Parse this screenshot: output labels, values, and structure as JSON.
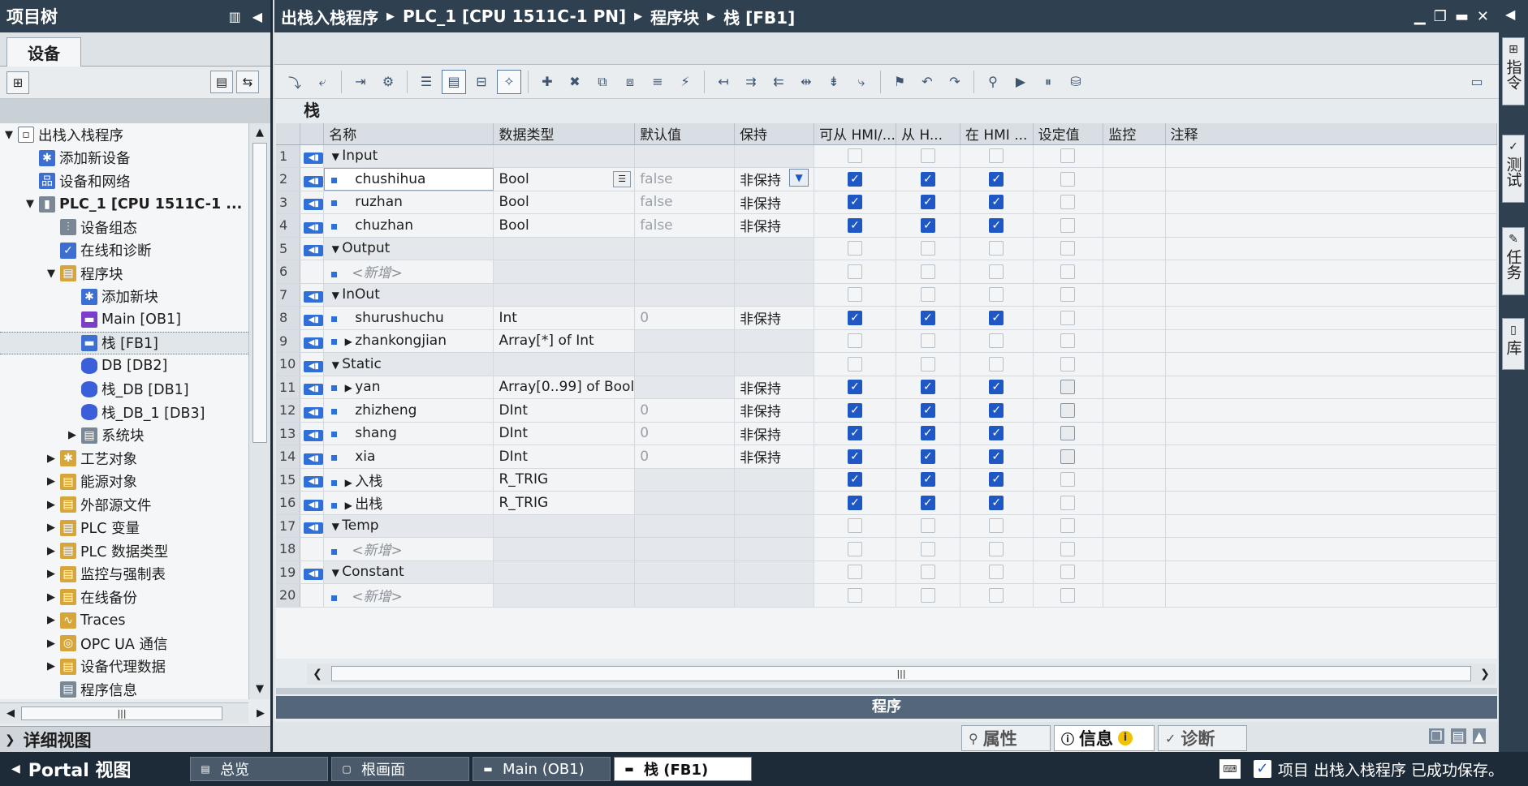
{
  "left": {
    "title": "项目树",
    "tab_devices": "设备",
    "tree": [
      {
        "label": "出栈入栈程序",
        "indent": 0,
        "arrow": "▼",
        "icon": "page",
        "glyph": "▫"
      },
      {
        "label": "添加新设备",
        "indent": 1,
        "arrow": "",
        "icon": "blue",
        "glyph": "✱"
      },
      {
        "label": "设备和网络",
        "indent": 1,
        "arrow": "",
        "icon": "blue",
        "glyph": "品"
      },
      {
        "label": "PLC_1 [CPU 1511C-1 ...",
        "indent": 1,
        "arrow": "▼",
        "icon": "gray",
        "glyph": "▮",
        "bold": true
      },
      {
        "label": "设备组态",
        "indent": 2,
        "arrow": "",
        "icon": "gray",
        "glyph": "⫶"
      },
      {
        "label": "在线和诊断",
        "indent": 2,
        "arrow": "",
        "icon": "blue",
        "glyph": "✓"
      },
      {
        "label": "程序块",
        "indent": 2,
        "arrow": "▼",
        "icon": "folder",
        "glyph": "▤"
      },
      {
        "label": "添加新块",
        "indent": 3,
        "arrow": "",
        "icon": "blue",
        "glyph": "✱"
      },
      {
        "label": "Main [OB1]",
        "indent": 3,
        "arrow": "",
        "icon": "purple",
        "glyph": "▬"
      },
      {
        "label": "栈 [FB1]",
        "indent": 3,
        "arrow": "",
        "icon": "blue",
        "glyph": "▬",
        "selected": true
      },
      {
        "label": "DB [DB2]",
        "indent": 3,
        "arrow": "",
        "icon": "db",
        "glyph": ""
      },
      {
        "label": "栈_DB [DB1]",
        "indent": 3,
        "arrow": "",
        "icon": "db",
        "glyph": ""
      },
      {
        "label": "栈_DB_1 [DB3]",
        "indent": 3,
        "arrow": "",
        "icon": "db",
        "glyph": ""
      },
      {
        "label": "系统块",
        "indent": 3,
        "arrow": "▶",
        "icon": "gray",
        "glyph": "▤"
      },
      {
        "label": "工艺对象",
        "indent": 2,
        "arrow": "▶",
        "icon": "folder",
        "glyph": "✱"
      },
      {
        "label": "能源对象",
        "indent": 2,
        "arrow": "▶",
        "icon": "folder",
        "glyph": "▤"
      },
      {
        "label": "外部源文件",
        "indent": 2,
        "arrow": "▶",
        "icon": "folder",
        "glyph": "▤"
      },
      {
        "label": "PLC 变量",
        "indent": 2,
        "arrow": "▶",
        "icon": "folder",
        "glyph": "▤"
      },
      {
        "label": "PLC 数据类型",
        "indent": 2,
        "arrow": "▶",
        "icon": "folder",
        "glyph": "▤"
      },
      {
        "label": "监控与强制表",
        "indent": 2,
        "arrow": "▶",
        "icon": "folder",
        "glyph": "▤"
      },
      {
        "label": "在线备份",
        "indent": 2,
        "arrow": "▶",
        "icon": "folder",
        "glyph": "▤"
      },
      {
        "label": "Traces",
        "indent": 2,
        "arrow": "▶",
        "icon": "folder",
        "glyph": "∿"
      },
      {
        "label": "OPC UA 通信",
        "indent": 2,
        "arrow": "▶",
        "icon": "folder",
        "glyph": "◎"
      },
      {
        "label": "设备代理数据",
        "indent": 2,
        "arrow": "▶",
        "icon": "folder",
        "glyph": "▤"
      },
      {
        "label": "程序信息",
        "indent": 2,
        "arrow": "",
        "icon": "gray",
        "glyph": "▤"
      }
    ],
    "detail_view": "详细视图"
  },
  "main": {
    "breadcrumb": [
      "出栈入栈程序",
      "PLC_1 [CPU 1511C-1 PN]",
      "程序块",
      "栈 [FB1]"
    ],
    "block_name": "栈",
    "columns": [
      "名称",
      "数据类型",
      "默认值",
      "保持",
      "可从 HMI/...",
      "从 H...",
      "在 HMI ...",
      "设定值",
      "监控",
      "注释"
    ],
    "rows": [
      {
        "n": "1",
        "name": "Input",
        "kind": "section",
        "iface": true
      },
      {
        "n": "2",
        "name": "chushihua",
        "type": "Bool",
        "def": "false",
        "ret": "非保持",
        "h1": true,
        "h2": true,
        "h3": true,
        "sp": "off",
        "sel": true
      },
      {
        "n": "3",
        "name": "ruzhan",
        "type": "Bool",
        "def": "false",
        "ret": "非保持",
        "h1": true,
        "h2": true,
        "h3": true,
        "sp": "off"
      },
      {
        "n": "4",
        "name": "chuzhan",
        "type": "Bool",
        "def": "false",
        "ret": "非保持",
        "h1": true,
        "h2": true,
        "h3": true,
        "sp": "off"
      },
      {
        "n": "5",
        "name": "Output",
        "kind": "section",
        "iface": true
      },
      {
        "n": "6",
        "name": "<新增>",
        "kind": "add"
      },
      {
        "n": "7",
        "name": "InOut",
        "kind": "section",
        "iface": true
      },
      {
        "n": "8",
        "name": "shurushuchu",
        "type": "Int",
        "def": "0",
        "ret": "非保持",
        "h1": true,
        "h2": true,
        "h3": true,
        "sp": "off"
      },
      {
        "n": "9",
        "name": "zhankongjian",
        "type": "Array[*] of Int",
        "def": "",
        "ret": "",
        "h1": false,
        "h2": false,
        "h3": false,
        "sp": "off",
        "expand": true
      },
      {
        "n": "10",
        "name": "Static",
        "kind": "section",
        "iface": true
      },
      {
        "n": "11",
        "name": "yan",
        "type": "Array[0..99] of Bool",
        "def": "",
        "ret": "非保持",
        "h1": true,
        "h2": true,
        "h3": true,
        "sp": "mid",
        "expand": true
      },
      {
        "n": "12",
        "name": "zhizheng",
        "type": "DInt",
        "def": "0",
        "ret": "非保持",
        "h1": true,
        "h2": true,
        "h3": true,
        "sp": "mid"
      },
      {
        "n": "13",
        "name": "shang",
        "type": "DInt",
        "def": "0",
        "ret": "非保持",
        "h1": true,
        "h2": true,
        "h3": true,
        "sp": "mid"
      },
      {
        "n": "14",
        "name": "xia",
        "type": "DInt",
        "def": "0",
        "ret": "非保持",
        "h1": true,
        "h2": true,
        "h3": true,
        "sp": "mid"
      },
      {
        "n": "15",
        "name": "入栈",
        "type": "R_TRIG",
        "def": "",
        "ret": "",
        "h1": true,
        "h2": true,
        "h3": true,
        "sp": "off",
        "expand": true
      },
      {
        "n": "16",
        "name": "出栈",
        "type": "R_TRIG",
        "def": "",
        "ret": "",
        "h1": true,
        "h2": true,
        "h3": true,
        "sp": "off",
        "expand": true
      },
      {
        "n": "17",
        "name": "Temp",
        "kind": "section",
        "iface": true
      },
      {
        "n": "18",
        "name": "<新增>",
        "kind": "add"
      },
      {
        "n": "19",
        "name": "Constant",
        "kind": "section",
        "iface": true
      },
      {
        "n": "20",
        "name": "<新增>",
        "kind": "add"
      }
    ],
    "program_bar": "程序",
    "inspector_tabs": {
      "properties": "属性",
      "info": "信息",
      "diagnostics": "诊断"
    }
  },
  "rightbar": {
    "tabs": [
      "指令",
      "测试",
      "任务",
      "库"
    ]
  },
  "statusbar": {
    "portal": "Portal 视图",
    "tabs": [
      {
        "label": "总览",
        "icon": "▤",
        "active": false,
        "width": 170
      },
      {
        "label": "根画面",
        "icon": "▢",
        "active": false,
        "width": 170
      },
      {
        "label": "Main (OB1)",
        "icon": "▬",
        "active": false,
        "width": 170
      },
      {
        "label": "栈 (FB1)",
        "icon": "▬",
        "active": true,
        "width": 170
      }
    ],
    "message": "项目 出栈入栈程序 已成功保存。"
  },
  "colors": {
    "title_bar": "#2f4050",
    "accent": "#1f58c4",
    "status_bar": "#1d2b39"
  }
}
